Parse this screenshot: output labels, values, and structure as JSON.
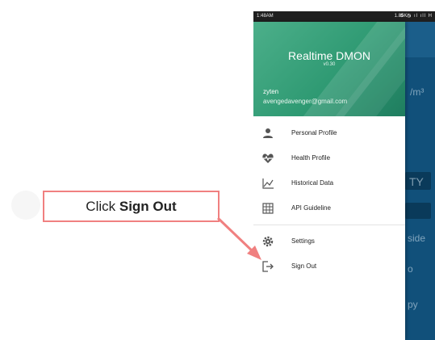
{
  "status_bar": {
    "time": "1:48AM",
    "speed": "1.85K/s",
    "icons": "⚙ ◷ ıl ıll H"
  },
  "drawer": {
    "app_title": "Realtime DMON",
    "version": "v0.30",
    "user_name": "zyten",
    "user_email": "avengedavenger@gmail.com",
    "items": [
      {
        "label": "Personal Profile",
        "icon": "person-icon"
      },
      {
        "label": "Health Profile",
        "icon": "heart-pulse-icon"
      },
      {
        "label": "Historical Data",
        "icon": "line-chart-icon"
      },
      {
        "label": "API Guideline",
        "icon": "grid-icon"
      },
      {
        "label": "Settings",
        "icon": "gear-icon"
      },
      {
        "label": "Sign Out",
        "icon": "sign-out-icon"
      }
    ]
  },
  "background_app": {
    "unit": "/m³",
    "quality": "TY",
    "side": "side",
    "o": "o",
    "py": "py"
  },
  "callout": {
    "prefix": "Click ",
    "action": "Sign Out"
  },
  "colors": {
    "header_green": "#2f9a73",
    "app_blue": "#11507a",
    "callout_border": "#f08080",
    "arrow": "#f08080"
  }
}
